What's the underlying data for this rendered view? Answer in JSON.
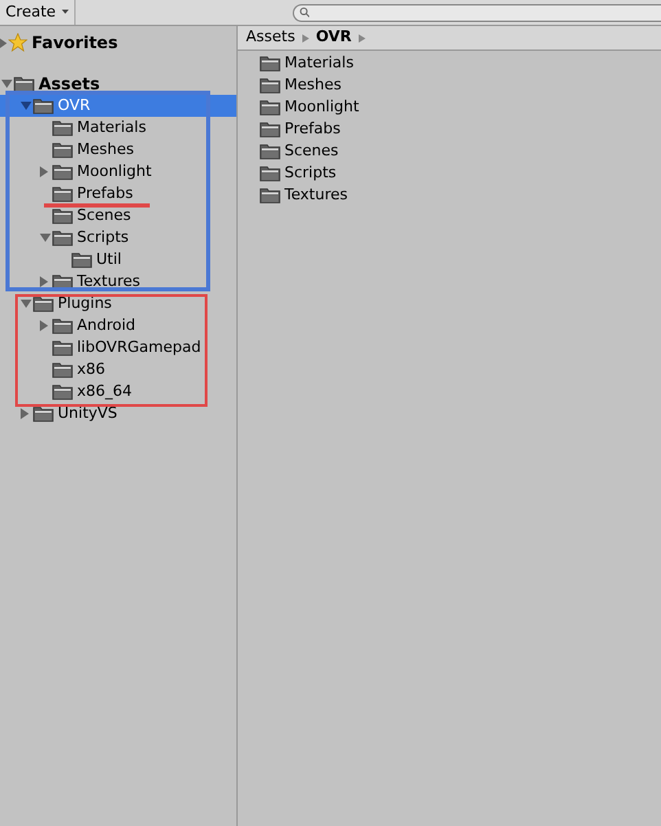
{
  "toolbar": {
    "create_label": "Create"
  },
  "favorites": {
    "label": "Favorites"
  },
  "tree": [
    {
      "label": "Assets",
      "expanded": true,
      "selected": false,
      "children": [
        {
          "label": "OVR",
          "expanded": true,
          "selected": true,
          "children": [
            {
              "label": "Materials",
              "selected": false
            },
            {
              "label": "Meshes",
              "selected": false
            },
            {
              "label": "Moonlight",
              "expanded": false,
              "selected": false
            },
            {
              "label": "Prefabs",
              "selected": false
            },
            {
              "label": "Scenes",
              "selected": false
            },
            {
              "label": "Scripts",
              "expanded": true,
              "selected": false,
              "children": [
                {
                  "label": "Util",
                  "selected": false
                }
              ]
            },
            {
              "label": "Textures",
              "expanded": false,
              "selected": false
            }
          ]
        },
        {
          "label": "Plugins",
          "expanded": true,
          "selected": false,
          "children": [
            {
              "label": "Android",
              "expanded": false,
              "selected": false
            },
            {
              "label": "libOVRGamepad",
              "selected": false
            },
            {
              "label": "x86",
              "selected": false
            },
            {
              "label": "x86_64",
              "selected": false
            }
          ]
        },
        {
          "label": "UnityVS",
          "expanded": false,
          "selected": false
        }
      ]
    }
  ],
  "breadcrumb": [
    {
      "label": "Assets",
      "current": false
    },
    {
      "label": "OVR",
      "current": true
    }
  ],
  "contents": [
    {
      "label": "Materials"
    },
    {
      "label": "Meshes"
    },
    {
      "label": "Moonlight"
    },
    {
      "label": "Prefabs"
    },
    {
      "label": "Scenes"
    },
    {
      "label": "Scripts"
    },
    {
      "label": "Textures"
    }
  ],
  "annotations": [
    {
      "kind": "box",
      "color": "#4a78d4"
    },
    {
      "kind": "underline",
      "color": "#e04848"
    },
    {
      "kind": "box",
      "color": "#e04848"
    }
  ]
}
